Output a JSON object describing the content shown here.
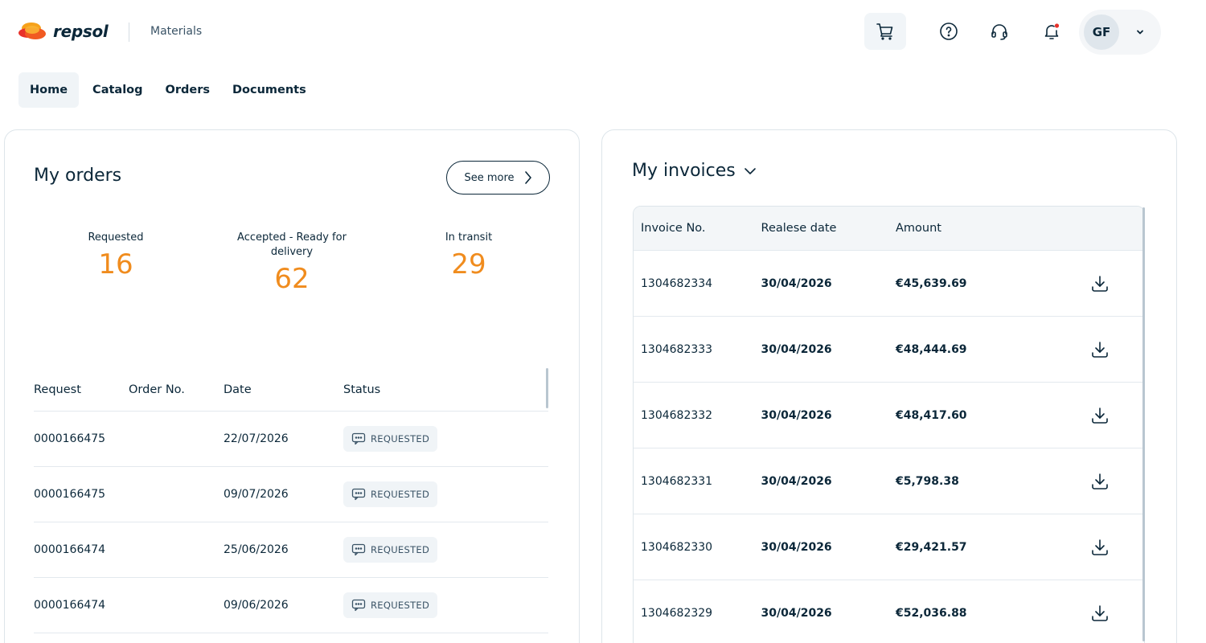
{
  "brand": {
    "name": "repsol",
    "app": "Materials",
    "accent": "#f08c1e",
    "logo_colors": [
      "#f6a21b",
      "#e8312a",
      "#f15a22"
    ]
  },
  "header": {
    "icons": [
      "cart-icon",
      "help-icon",
      "headset-icon",
      "bell-icon"
    ],
    "user": {
      "initials": "GF"
    }
  },
  "nav": {
    "items": [
      "Home",
      "Catalog",
      "Orders",
      "Documents"
    ],
    "active": "Home"
  },
  "orders": {
    "title": "My orders",
    "see_more": "See more",
    "stats": [
      {
        "label": "Requested",
        "value": "16"
      },
      {
        "label": "Accepted - Ready for delivery",
        "value": "62"
      },
      {
        "label": "In transit",
        "value": "29"
      }
    ],
    "columns": [
      "Request",
      "Order No.",
      "Date",
      "Status"
    ],
    "rows": [
      {
        "request": "0000166475",
        "order_no": "",
        "date": "22/07/2026",
        "status": "REQUESTED"
      },
      {
        "request": "0000166475",
        "order_no": "",
        "date": "09/07/2026",
        "status": "REQUESTED"
      },
      {
        "request": "0000166474",
        "order_no": "",
        "date": "25/06/2026",
        "status": "REQUESTED"
      },
      {
        "request": "0000166474",
        "order_no": "",
        "date": "09/06/2026",
        "status": "REQUESTED"
      }
    ]
  },
  "invoices": {
    "title": "My invoices",
    "columns": [
      "Invoice No.",
      "Realese date",
      "Amount"
    ],
    "rows": [
      {
        "no": "1304682334",
        "date": "30/04/2026",
        "amount": "€45,639.69"
      },
      {
        "no": "1304682333",
        "date": "30/04/2026",
        "amount": "€48,444.69"
      },
      {
        "no": "1304682332",
        "date": "30/04/2026",
        "amount": "€48,417.60"
      },
      {
        "no": "1304682331",
        "date": "30/04/2026",
        "amount": "€5,798.38"
      },
      {
        "no": "1304682330",
        "date": "30/04/2026",
        "amount": "€29,421.57"
      },
      {
        "no": "1304682329",
        "date": "30/04/2026",
        "amount": "€52,036.88"
      }
    ]
  }
}
